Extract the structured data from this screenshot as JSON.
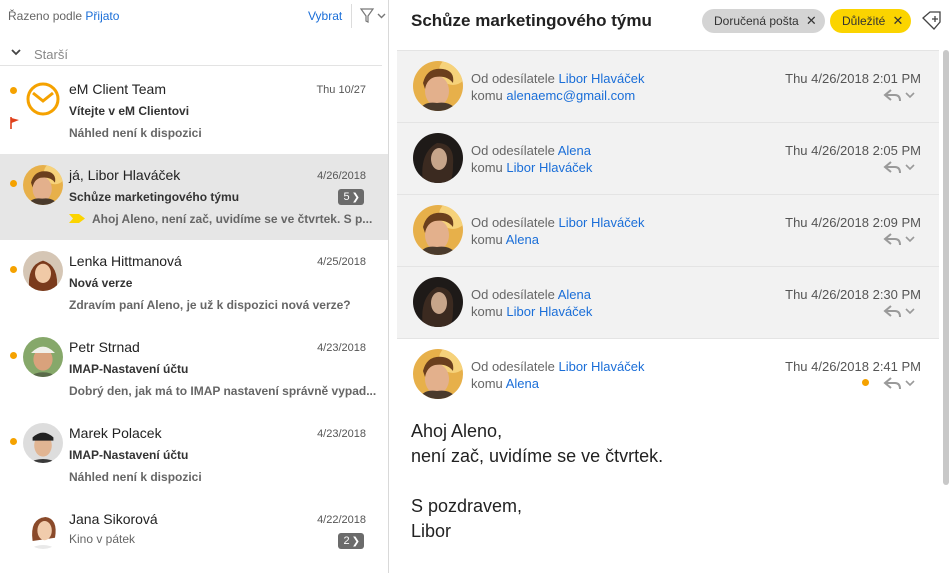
{
  "list": {
    "sort_prefix": "Řazeno podle",
    "sort_value": "Přijato",
    "select_label": "Vybrat",
    "filter_icon": "funnel-icon",
    "group_label": "Starší",
    "messages": [
      {
        "from": "eM Client Team",
        "date": "Thu 10/27",
        "subject": "Vítejte v eM Clientovi",
        "preview": "Náhled není k dispozici",
        "unread": true,
        "flagged": true
      },
      {
        "from": "já, Libor Hlaváček",
        "date": "4/26/2018",
        "subject": "Schůze marketingového týmu",
        "preview": "Ahoj Aleno, není zač, uvidíme se ve čtvrtek. S p...",
        "count": "5",
        "unread": true,
        "selected": true
      },
      {
        "from": "Lenka Hittmanová",
        "date": "4/25/2018",
        "subject": "Nová verze",
        "preview": "Zdravím paní Aleno, je už k dispozici nová verze?",
        "unread": true
      },
      {
        "from": "Petr Strnad",
        "date": "4/23/2018",
        "subject": "IMAP-Nastavení účtu",
        "preview": "Dobrý den, jak má to IMAP nastavení správně vypad...",
        "unread": true
      },
      {
        "from": "Marek Polacek",
        "date": "4/23/2018",
        "subject": "IMAP-Nastavení účtu",
        "preview": "Náhled není k dispozici",
        "unread": true
      },
      {
        "from": "Jana Sikorová",
        "date": "4/22/2018",
        "preview": "Kino v pátek",
        "count": "2"
      }
    ]
  },
  "conversation": {
    "title": "Schůze marketingového týmu",
    "tags": [
      {
        "label": "Doručená pošta",
        "color": "#d4d4d4"
      },
      {
        "label": "Důležité",
        "color": "#fbd400"
      }
    ],
    "from_prefix": "Od odesílatele",
    "to_prefix": "komu",
    "messages": [
      {
        "sender": "Libor Hlaváček",
        "recipient": "alenaemc@gmail.com",
        "date": "Thu 4/26/2018 2:01 PM"
      },
      {
        "sender": "Alena",
        "recipient": "Libor Hlaváček",
        "date": "Thu 4/26/2018 2:05 PM"
      },
      {
        "sender": "Libor Hlaváček",
        "recipient": "Alena",
        "date": "Thu 4/26/2018 2:09 PM"
      },
      {
        "sender": "Alena",
        "recipient": "Libor Hlaváček",
        "date": "Thu 4/26/2018 2:30 PM"
      },
      {
        "sender": "Libor Hlaváček",
        "recipient": "Alena",
        "date": "Thu 4/26/2018 2:41 PM",
        "unread": true
      }
    ],
    "body": "Ahoj Aleno,\nnení zač, uvidíme se ve čtvrtek.\n\nS pozdravem,\nLibor"
  },
  "colors": {
    "accent": "#1a6ed8",
    "unread_dot": "#f5a200",
    "important": "#fbd400",
    "flag": "#e0401b"
  }
}
